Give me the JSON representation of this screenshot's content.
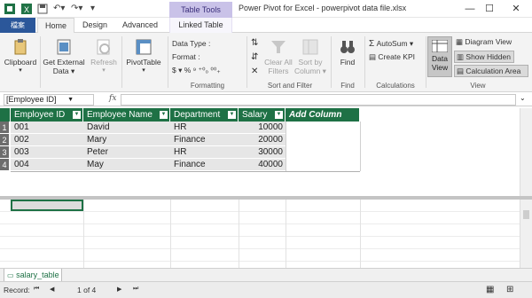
{
  "titlebar": {
    "contextual_tab": "Table Tools",
    "title": "Power Pivot for Excel - powerpivot data file.xlsx",
    "minimize": "—",
    "restore": "☐",
    "close": "✕"
  },
  "tabs": {
    "file": "檔案",
    "home": "Home",
    "design": "Design",
    "advanced": "Advanced",
    "linked_table": "Linked Table"
  },
  "ribbon": {
    "clipboard": "Clipboard",
    "get_external_data": [
      "Get External",
      "Data ▾"
    ],
    "refresh": [
      "Refresh",
      "▾"
    ],
    "pivottable": [
      "PivotTable",
      "▾"
    ],
    "data_type": "Data Type :",
    "format": "Format :",
    "currency_row": "$ ▾  %  ⁹  ⁺⁰₀  ⁰⁰₊",
    "formatting_label": "Formatting",
    "clear_all_filters": [
      "Clear All",
      "Filters"
    ],
    "sort_by_column": [
      "Sort by",
      "Column ▾"
    ],
    "sort_filter_label": "Sort and Filter",
    "find": "Find",
    "find_label": "Find",
    "autosum": "AutoSum ▾",
    "create_kpi": "Create KPI",
    "calculations_label": "Calculations",
    "data_view": [
      "Data",
      "View"
    ],
    "diagram_view": "Diagram View",
    "show_hidden": "Show Hidden",
    "calculation_area": "Calculation Area",
    "view_label": "View"
  },
  "formula_bar": {
    "name_box": "[Employee ID]",
    "fx": "fx",
    "formula": ""
  },
  "table": {
    "columns": [
      "Employee ID",
      "Employee Name",
      "Department",
      "Salary",
      "Add Column"
    ],
    "rows": [
      {
        "num": "1",
        "id": "001",
        "name": "David",
        "dept": "HR",
        "salary": "10000"
      },
      {
        "num": "2",
        "id": "002",
        "name": "Mary",
        "dept": "Finance",
        "salary": "20000"
      },
      {
        "num": "3",
        "id": "003",
        "name": "Peter",
        "dept": "HR",
        "salary": "30000"
      },
      {
        "num": "4",
        "id": "004",
        "name": "May",
        "dept": "Finance",
        "salary": "40000"
      }
    ]
  },
  "sheet_tab": "salary_table",
  "status": {
    "record_label": "Record:",
    "first": "⏮",
    "prev": "◀",
    "position": "1 of 4",
    "next": "▶",
    "last": "⏭"
  },
  "colors": {
    "header_green": "#1e7145",
    "table_tools_purple": "#c9c2e8",
    "file_tab_blue": "#2b579a"
  }
}
